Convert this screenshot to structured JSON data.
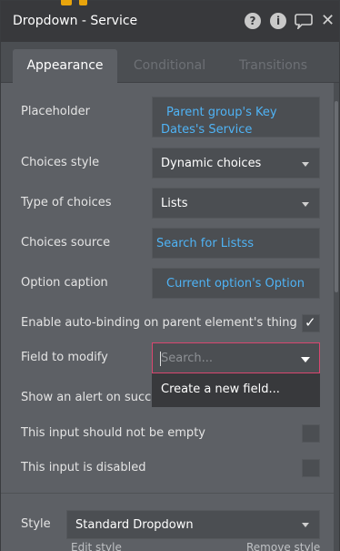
{
  "header": {
    "title": "Dropdown - Service"
  },
  "tabs": [
    {
      "label": "Appearance"
    },
    {
      "label": "Conditional"
    },
    {
      "label": "Transitions"
    }
  ],
  "form": {
    "placeholder": {
      "label": "Placeholder",
      "value": "Parent group's Key Dates's Service"
    },
    "choices_style": {
      "label": "Choices style",
      "value": "Dynamic choices"
    },
    "type_of_choices": {
      "label": "Type of choices",
      "value": "Lists"
    },
    "choices_source": {
      "label": "Choices source",
      "value": "Search for Listss"
    },
    "option_caption": {
      "label": "Option caption",
      "value": "Current option's Option"
    },
    "auto_binding": {
      "label": "Enable auto-binding on parent element's thing",
      "checked": true
    },
    "field_to_modify": {
      "label": "Field to modify",
      "placeholder": "Search...",
      "menu_item": "Create a new field..."
    },
    "show_alert": {
      "label": "Show an alert on success"
    },
    "not_empty": {
      "label": "This input should not be empty",
      "checked": false
    },
    "disabled": {
      "label": "This input is disabled",
      "checked": false
    },
    "style": {
      "label": "Style",
      "value": "Standard Dropdown",
      "edit_label": "Edit style",
      "remove_label": "Remove style"
    }
  },
  "colors": {
    "header_bg": "#38393c",
    "panel_bg": "#5d6065",
    "link": "#4fb3f5",
    "focus_border": "#d9466f",
    "badge": "#e8a40c"
  }
}
